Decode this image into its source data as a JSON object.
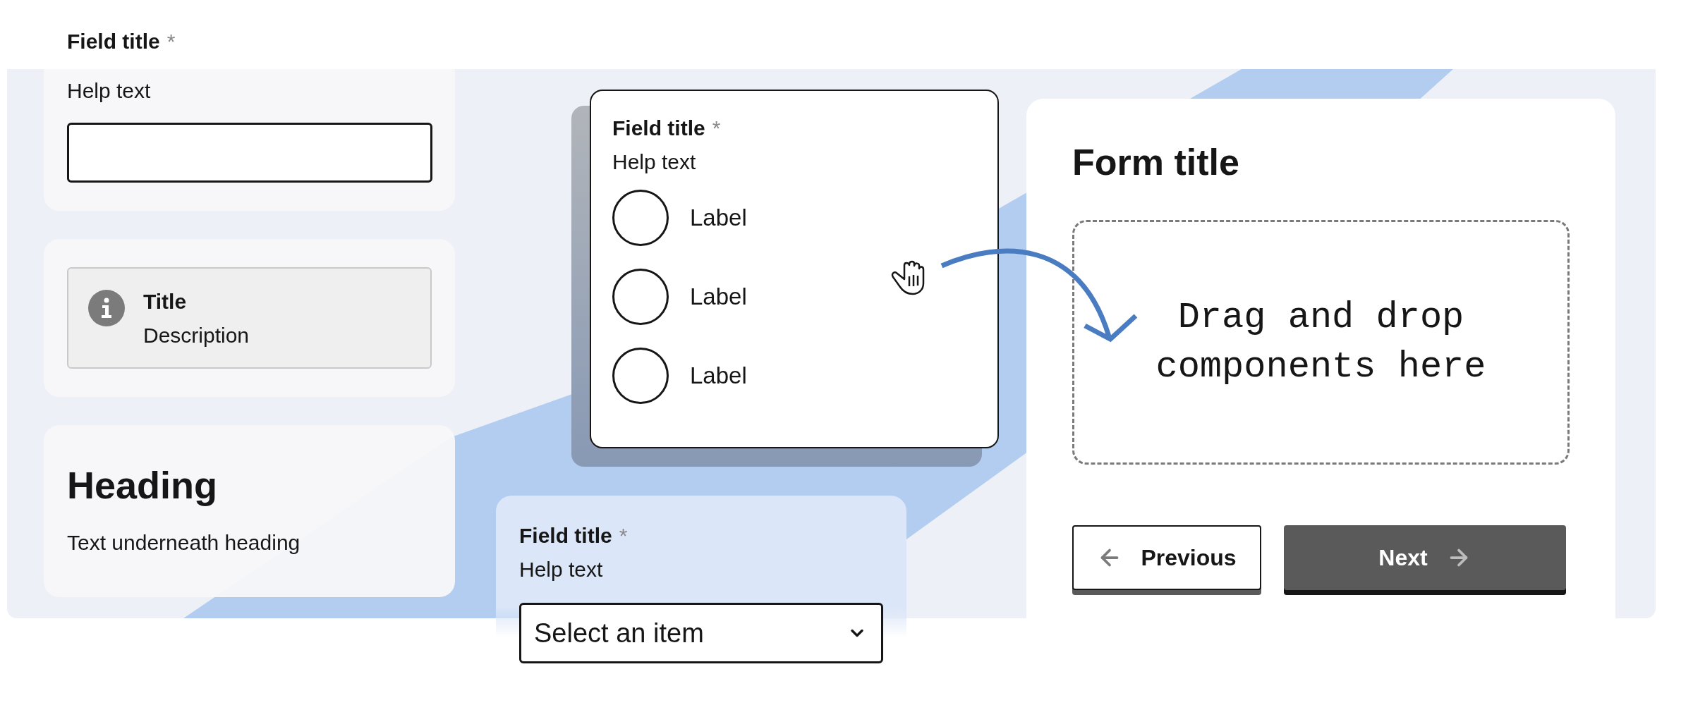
{
  "top_field": {
    "title": "Field title",
    "required_mark": "*",
    "help_text": "Help text"
  },
  "notice": {
    "title": "Title",
    "description": "Description"
  },
  "heading_block": {
    "heading": "Heading",
    "text": "Text underneath heading"
  },
  "dragged_field": {
    "title": "Field title",
    "required_mark": "*",
    "help_text": "Help text",
    "options": [
      {
        "label": "Label",
        "selected": false
      },
      {
        "label": "Label",
        "selected": false
      },
      {
        "label": "Label",
        "selected": false
      }
    ]
  },
  "select_field": {
    "title": "Field title",
    "required_mark": "*",
    "help_text": "Help text",
    "value": "Select an item"
  },
  "form": {
    "title": "Form title",
    "drop_zone": "Drag and drop components here",
    "buttons": [
      {
        "label": "Previous",
        "kind": "secondary"
      },
      {
        "label": "Next",
        "kind": "primary"
      }
    ]
  }
}
